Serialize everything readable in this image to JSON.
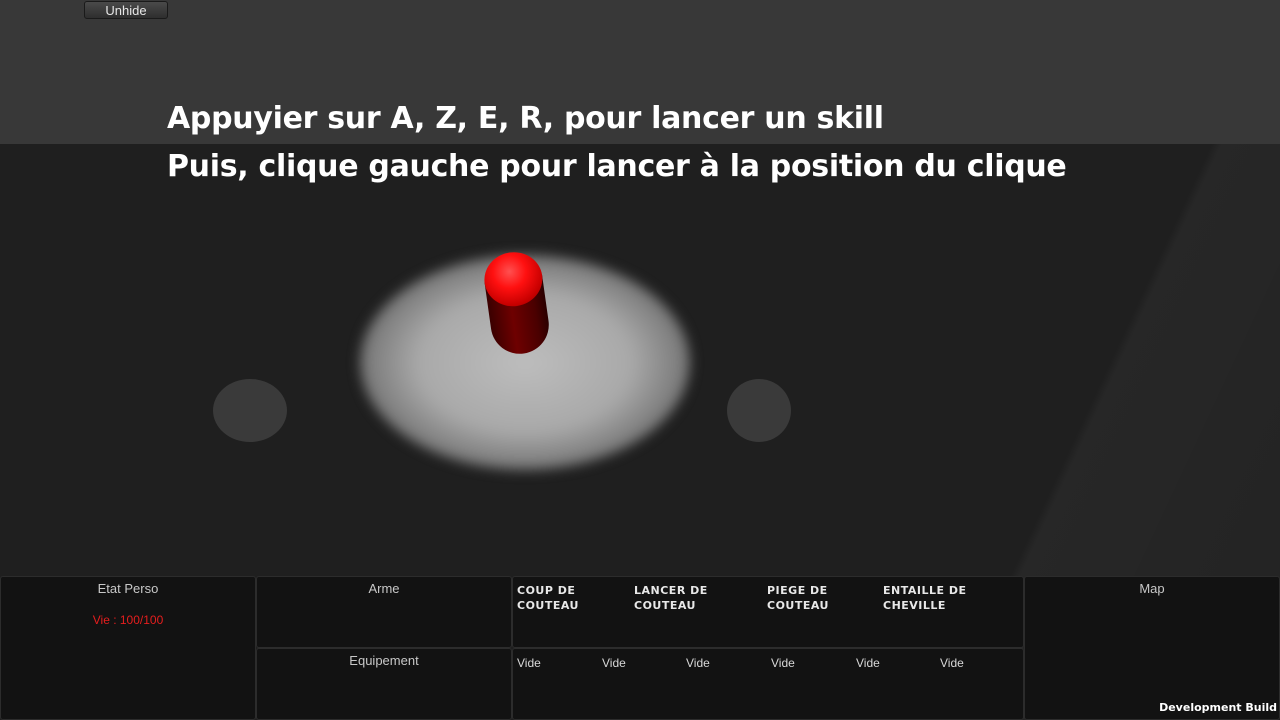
{
  "toolbar": {
    "unhide_label": "Unhide"
  },
  "instructions": {
    "line1": "Appuyier sur A, Z, E, R, pour lancer un skill",
    "line2": "Puis, clique gauche pour lancer à la position du clique"
  },
  "panels": {
    "etat": {
      "title": "Etat Perso",
      "life": "Vie : 100/100",
      "life_color": "#e61e1e"
    },
    "arme": {
      "title": "Arme"
    },
    "equipement": {
      "title": "Equipement"
    },
    "map": {
      "title": "Map"
    }
  },
  "skills": [
    {
      "label": "Coup de couteau"
    },
    {
      "label": "Lancer de couteau"
    },
    {
      "label": "Piege de couteau"
    },
    {
      "label": "Entaille de cheville"
    }
  ],
  "inventory": [
    "Vide",
    "Vide",
    "Vide",
    "Vide",
    "Vide",
    "Vide"
  ],
  "footer": {
    "dev_build": "Development Build"
  },
  "colors": {
    "player": "#ff1010",
    "background": "#1f1f1f",
    "top_band": "#383838"
  }
}
